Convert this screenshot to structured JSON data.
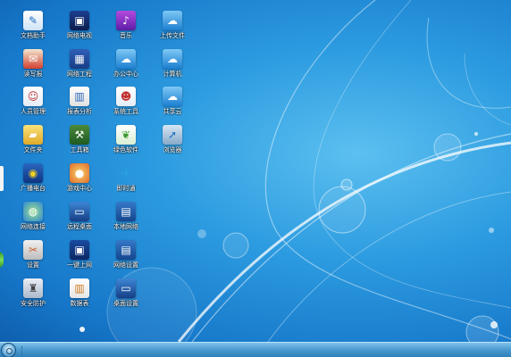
{
  "desktop": {
    "icons": [
      {
        "label": "文档助手",
        "icon": "document-icon",
        "glyph": "✎",
        "cls": "i-doc"
      },
      {
        "label": "网络电视",
        "icon": "tv-icon",
        "glyph": "▣",
        "cls": "i-tv"
      },
      {
        "label": "音乐",
        "icon": "music-icon",
        "glyph": "♪",
        "cls": "i-music"
      },
      {
        "label": "上传文件",
        "icon": "cloud-icon",
        "glyph": "☁",
        "cls": "i-cloud"
      },
      {
        "label": "读写报",
        "icon": "newspaper-icon",
        "glyph": "✉",
        "cls": "i-red"
      },
      {
        "label": "网络工程",
        "icon": "bars-icon",
        "glyph": "▦",
        "cls": "i-bars"
      },
      {
        "label": "办公中心",
        "icon": "cloud-icon",
        "glyph": "☁",
        "cls": "i-cloud"
      },
      {
        "label": "计算机",
        "icon": "cloud-icon",
        "glyph": "☁",
        "cls": "i-cloud"
      },
      {
        "label": "人员管理",
        "icon": "people-icon",
        "glyph": "☺",
        "cls": "i-people"
      },
      {
        "label": "报表分析",
        "icon": "chart-icon",
        "glyph": "▥",
        "cls": "i-chart"
      },
      {
        "label": "系统工具",
        "icon": "people-icon",
        "glyph": "☻",
        "cls": "i-people"
      },
      {
        "label": "共享云",
        "icon": "cloud-icon",
        "glyph": "☁",
        "cls": "i-cloud"
      },
      {
        "label": "文件夹",
        "icon": "folder-icon",
        "glyph": "▰",
        "cls": "i-folder"
      },
      {
        "label": "工具箱",
        "icon": "toolbox-icon",
        "glyph": "⚒",
        "cls": "i-tool"
      },
      {
        "label": "绿色软件",
        "icon": "leaf-icon",
        "glyph": "❦",
        "cls": "i-leaf"
      },
      {
        "label": "浏览器",
        "icon": "compass-icon",
        "glyph": "➚",
        "cls": "i-safari"
      },
      {
        "label": "广播电台",
        "icon": "radio-icon",
        "glyph": "◉",
        "cls": "i-radio"
      },
      {
        "label": "游戏中心",
        "icon": "ball-icon",
        "glyph": "●",
        "cls": "i-ball"
      },
      {
        "label": "即时通",
        "icon": "bird-icon",
        "glyph": "✈",
        "cls": "i-bird"
      },
      {
        "label": "网络连接",
        "icon": "globe-icon",
        "glyph": "◍",
        "cls": "i-globe"
      },
      {
        "label": "远程桌面",
        "icon": "monitor-icon",
        "glyph": "▭",
        "cls": "i-monitor"
      },
      {
        "label": "本地网络",
        "icon": "network-icon",
        "glyph": "▤",
        "cls": "i-grid"
      },
      {
        "label": "设置",
        "icon": "tools-icon",
        "glyph": "✂",
        "cls": "i-tools2"
      },
      {
        "label": "一键上网",
        "icon": "screen-icon",
        "glyph": "▣",
        "cls": "i-screen"
      },
      {
        "label": "网络设置",
        "icon": "network-icon",
        "glyph": "▤",
        "cls": "i-grid"
      },
      {
        "label": "安全防护",
        "icon": "shield-icon",
        "glyph": "♜",
        "cls": "i-shield"
      },
      {
        "label": "数据表",
        "icon": "spreadsheet-icon",
        "glyph": "▥",
        "cls": "i-sheet"
      },
      {
        "label": "桌面设置",
        "icon": "monitor-icon",
        "glyph": "▭",
        "cls": "i-monitor"
      }
    ]
  },
  "taskbar": {
    "start_icon": "start-orb-icon"
  },
  "colors": {
    "wallpaper_accent": "#2c9be0",
    "taskbar": "#4a9ad0"
  }
}
